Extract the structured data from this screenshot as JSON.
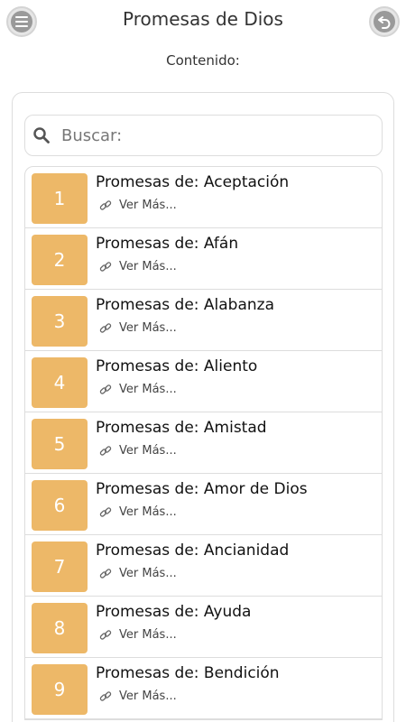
{
  "header": {
    "title": "Promesas de Dios",
    "subtitle": "Contenido:"
  },
  "search": {
    "placeholder": "Buscar:"
  },
  "list": {
    "items": [
      {
        "number": "1",
        "title": "Promesas de: Aceptación",
        "more": "Ver Más..."
      },
      {
        "number": "2",
        "title": "Promesas de: Afán",
        "more": "Ver Más..."
      },
      {
        "number": "3",
        "title": "Promesas de: Alabanza",
        "more": "Ver Más..."
      },
      {
        "number": "4",
        "title": "Promesas de: Aliento",
        "more": "Ver Más..."
      },
      {
        "number": "5",
        "title": "Promesas de: Amistad",
        "more": "Ver Más..."
      },
      {
        "number": "6",
        "title": "Promesas de: Amor de Dios",
        "more": "Ver Más..."
      },
      {
        "number": "7",
        "title": "Promesas de: Ancianidad",
        "more": "Ver Más..."
      },
      {
        "number": "8",
        "title": "Promesas de: Ayuda",
        "more": "Ver Más..."
      },
      {
        "number": "9",
        "title": "Promesas de: Bendición",
        "more": "Ver Más..."
      }
    ]
  },
  "colors": {
    "accent": "#edb868",
    "border": "#dddddd",
    "button": "#9a9a9a"
  },
  "icons": {
    "menu": "menu-icon",
    "back": "back-icon",
    "search": "search-icon",
    "link": "link-icon"
  }
}
